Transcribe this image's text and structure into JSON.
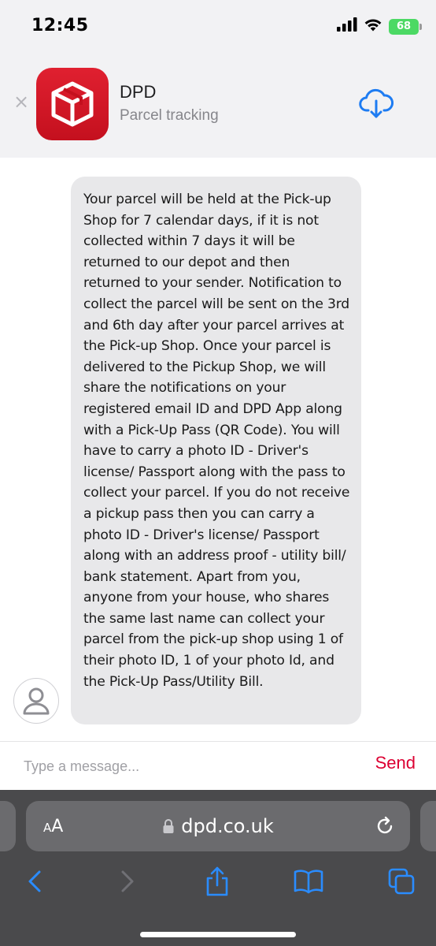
{
  "status_bar": {
    "time": "12:45",
    "battery": "68"
  },
  "app_banner": {
    "app_name": "DPD",
    "subtitle": "Parcel tracking",
    "brand_color": "#dc0032"
  },
  "chat": {
    "message": "Your parcel will be held at the Pick-up Shop for 7 calendar days, if it is not collected within 7 days it will be returned to our depot and then returned to your sender. Notification to collect the parcel will be sent on the 3rd and 6th day after your parcel arrives at the Pick-up Shop. Once your parcel is delivered to the Pickup Shop, we will share the notifications on your registered email ID and DPD App along with a Pick-Up Pass (QR Code). You will have to carry a photo ID - Driver's license/ Passport along with the pass to collect your parcel. If you do not receive a pickup pass then you can carry a photo ID - Driver's license/ Passport along with an address proof - utility bill/ bank statement. Apart from you, anyone from your house, who shares the same last name can collect your parcel from the pick-up shop using 1 of their photo ID, 1 of your photo Id, and the Pick-Up Pass/Utility Bill."
  },
  "input": {
    "placeholder": "Type a message...",
    "value": "",
    "send_label": "Send"
  },
  "safari": {
    "aa_label_small": "A",
    "aa_label_large": "A",
    "url": "dpd.co.uk"
  },
  "icons": {
    "signal": "signal-icon",
    "wifi": "wifi-icon",
    "close": "close-icon",
    "download": "cloud-download-icon",
    "avatar": "user-icon",
    "lock": "lock-icon",
    "reload": "reload-icon",
    "back": "chevron-left-icon",
    "forward": "chevron-right-icon",
    "share": "share-icon",
    "bookmarks": "book-icon",
    "tabs": "tabs-icon"
  }
}
